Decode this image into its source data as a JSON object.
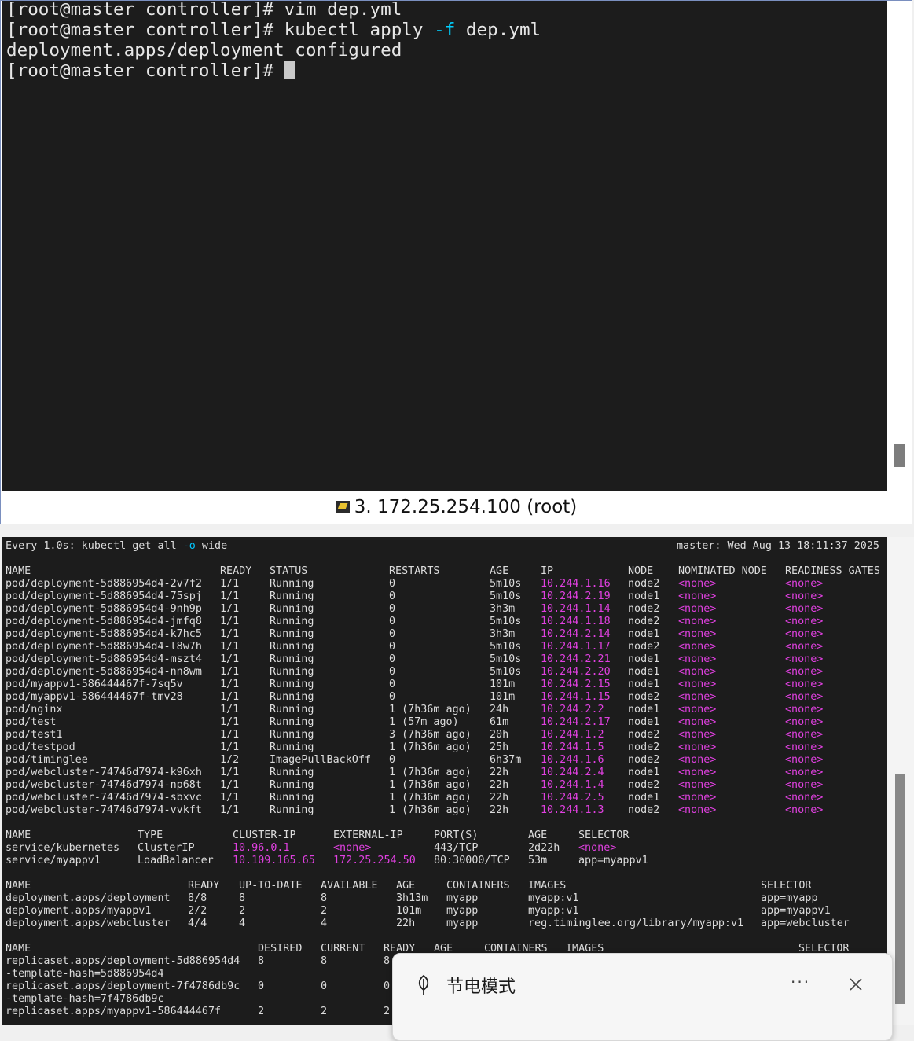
{
  "top_terminal": {
    "lines": {
      "l1": "[root@master controller]# vim dep.yml",
      "l2_pre": "[root@master controller]# kubectl apply ",
      "l2_flag": "-f",
      "l2_post": " dep.yml",
      "l3": "deployment.apps/deployment configured",
      "l4": "[root@master controller]# "
    },
    "tab_title": "3. 172.25.254.100 (root)"
  },
  "watch": {
    "header_pre": "Every 1.0s: kubectl get all ",
    "header_flag": "-o",
    "header_post": " wide",
    "header_right": "master: Wed Aug 13 18:11:37 2025",
    "pods_headers": [
      "NAME",
      "READY",
      "STATUS",
      "RESTARTS",
      "AGE",
      "IP",
      "NODE",
      "NOMINATED NODE",
      "READINESS GATES"
    ],
    "pods": [
      [
        "pod/deployment-5d886954d4-2v7f2",
        "1/1",
        "Running",
        "0",
        "5m10s",
        "10.244.1.16",
        "node2",
        "<none>",
        "<none>"
      ],
      [
        "pod/deployment-5d886954d4-75spj",
        "1/1",
        "Running",
        "0",
        "5m10s",
        "10.244.2.19",
        "node1",
        "<none>",
        "<none>"
      ],
      [
        "pod/deployment-5d886954d4-9nh9p",
        "1/1",
        "Running",
        "0",
        "3h3m",
        "10.244.1.14",
        "node2",
        "<none>",
        "<none>"
      ],
      [
        "pod/deployment-5d886954d4-jmfq8",
        "1/1",
        "Running",
        "0",
        "5m10s",
        "10.244.1.18",
        "node2",
        "<none>",
        "<none>"
      ],
      [
        "pod/deployment-5d886954d4-k7hc5",
        "1/1",
        "Running",
        "0",
        "3h3m",
        "10.244.2.14",
        "node1",
        "<none>",
        "<none>"
      ],
      [
        "pod/deployment-5d886954d4-l8w7h",
        "1/1",
        "Running",
        "0",
        "5m10s",
        "10.244.1.17",
        "node2",
        "<none>",
        "<none>"
      ],
      [
        "pod/deployment-5d886954d4-mszt4",
        "1/1",
        "Running",
        "0",
        "5m10s",
        "10.244.2.21",
        "node1",
        "<none>",
        "<none>"
      ],
      [
        "pod/deployment-5d886954d4-nn8wm",
        "1/1",
        "Running",
        "0",
        "5m10s",
        "10.244.2.20",
        "node1",
        "<none>",
        "<none>"
      ],
      [
        "pod/myappv1-586444467f-7sq5v",
        "1/1",
        "Running",
        "0",
        "101m",
        "10.244.2.15",
        "node1",
        "<none>",
        "<none>"
      ],
      [
        "pod/myappv1-586444467f-tmv28",
        "1/1",
        "Running",
        "0",
        "101m",
        "10.244.1.15",
        "node2",
        "<none>",
        "<none>"
      ],
      [
        "pod/nginx",
        "1/1",
        "Running",
        "1 (7h36m ago)",
        "24h",
        "10.244.2.2",
        "node1",
        "<none>",
        "<none>"
      ],
      [
        "pod/test",
        "1/1",
        "Running",
        "1 (57m ago)",
        "61m",
        "10.244.2.17",
        "node1",
        "<none>",
        "<none>"
      ],
      [
        "pod/test1",
        "1/1",
        "Running",
        "3 (7h36m ago)",
        "20h",
        "10.244.1.2",
        "node2",
        "<none>",
        "<none>"
      ],
      [
        "pod/testpod",
        "1/1",
        "Running",
        "1 (7h36m ago)",
        "25h",
        "10.244.1.5",
        "node2",
        "<none>",
        "<none>"
      ],
      [
        "pod/timinglee",
        "1/2",
        "ImagePullBackOff",
        "0",
        "6h37m",
        "10.244.1.6",
        "node2",
        "<none>",
        "<none>"
      ],
      [
        "pod/webcluster-74746d7974-k96xh",
        "1/1",
        "Running",
        "1 (7h36m ago)",
        "22h",
        "10.244.2.4",
        "node1",
        "<none>",
        "<none>"
      ],
      [
        "pod/webcluster-74746d7974-np68t",
        "1/1",
        "Running",
        "1 (7h36m ago)",
        "22h",
        "10.244.1.4",
        "node2",
        "<none>",
        "<none>"
      ],
      [
        "pod/webcluster-74746d7974-sbxvc",
        "1/1",
        "Running",
        "1 (7h36m ago)",
        "22h",
        "10.244.2.5",
        "node1",
        "<none>",
        "<none>"
      ],
      [
        "pod/webcluster-74746d7974-vvkft",
        "1/1",
        "Running",
        "1 (7h36m ago)",
        "22h",
        "10.244.1.3",
        "node2",
        "<none>",
        "<none>"
      ]
    ],
    "svc_headers": [
      "NAME",
      "TYPE",
      "CLUSTER-IP",
      "EXTERNAL-IP",
      "PORT(S)",
      "AGE",
      "SELECTOR"
    ],
    "services": [
      [
        "service/kubernetes",
        "ClusterIP",
        "10.96.0.1",
        "<none>",
        "443/TCP",
        "2d22h",
        "<none>"
      ],
      [
        "service/myappv1",
        "LoadBalancer",
        "10.109.165.65",
        "172.25.254.50",
        "80:30000/TCP",
        "53m",
        "app=myappv1"
      ]
    ],
    "dep_headers": [
      "NAME",
      "READY",
      "UP-TO-DATE",
      "AVAILABLE",
      "AGE",
      "CONTAINERS",
      "IMAGES",
      "SELECTOR"
    ],
    "deployments": [
      [
        "deployment.apps/deployment",
        "8/8",
        "8",
        "8",
        "3h13m",
        "myapp",
        "myapp:v1",
        "app=myapp"
      ],
      [
        "deployment.apps/myappv1",
        "2/2",
        "2",
        "2",
        "101m",
        "myapp",
        "myapp:v1",
        "app=myappv1"
      ],
      [
        "deployment.apps/webcluster",
        "4/4",
        "4",
        "4",
        "22h",
        "myapp",
        "reg.timinglee.org/library/myapp:v1",
        "app=webcluster"
      ]
    ],
    "rs_headers": [
      "NAME",
      "DESIRED",
      "CURRENT",
      "READY",
      "AGE",
      "CONTAINERS",
      "IMAGES",
      "SELECTOR"
    ],
    "replicasets": [
      [
        "replicaset.apps/deployment-5d886954d4",
        "8",
        "8",
        "8"
      ],
      [
        "-template-hash=5d886954d4"
      ],
      [
        "replicaset.apps/deployment-7f4786db9c",
        "0",
        "0",
        "0"
      ],
      [
        "-template-hash=7f4786db9c"
      ],
      [
        "replicaset.apps/myappv1-586444467f",
        "2",
        "2",
        "2"
      ]
    ]
  },
  "toast": {
    "title": "节电模式",
    "more": "···"
  },
  "colors": {
    "terminal_bg": "#1c1c1c",
    "ip_magenta": "#e040e0",
    "flag_cyan": "#00c8ff"
  }
}
